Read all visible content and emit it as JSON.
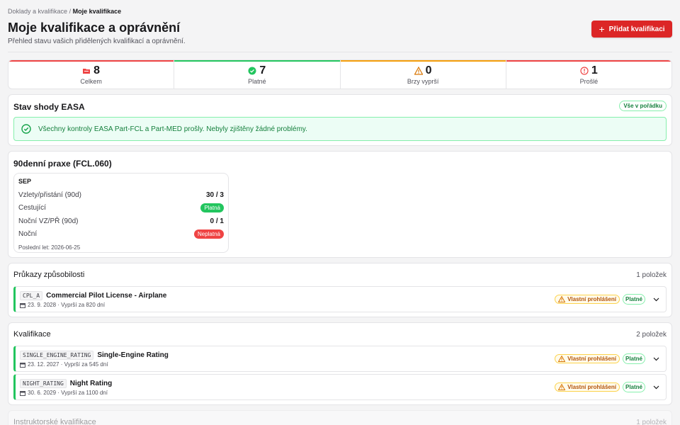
{
  "breadcrumb": {
    "parent": "Doklady a kvalifikace",
    "separator": "/",
    "current": "Moje kvalifikace"
  },
  "header": {
    "title": "Moje kvalifikace a oprávnění",
    "subtitle": "Přehled stavu vašich přidělených kvalifikací a oprávnění.",
    "add_button": "Přidat kvalifikaci"
  },
  "stats": [
    {
      "value": "8",
      "label": "Celkem",
      "icon": "folder-icon",
      "color": "#ef4444"
    },
    {
      "value": "7",
      "label": "Platné",
      "icon": "check-circle-icon",
      "color": "#22c55e"
    },
    {
      "value": "0",
      "label": "Brzy vyprší",
      "icon": "warning-icon",
      "color": "#f59e0b"
    },
    {
      "value": "1",
      "label": "Prošlé",
      "icon": "alert-circle-icon",
      "color": "#ef4444"
    }
  ],
  "easa": {
    "title": "Stav shody EASA",
    "badge": "Vše v pořádku",
    "message": "Všechny kontroly EASA Part-FCL a Part-MED prošly. Nebyly zjištěny žádné problémy."
  },
  "recency": {
    "title": "90denní praxe (FCL.060)",
    "type": "SEP",
    "rows": [
      {
        "label": "Vzlety/přistání (90d)",
        "value": "30 / 3"
      },
      {
        "label": "Cestující",
        "value": "Platná"
      },
      {
        "label": "Noční VZ/PŘ (90d)",
        "value": "0 / 1"
      },
      {
        "label": "Noční",
        "value": "Neplatná"
      }
    ],
    "last_flight": "Poslední let: 2026-06-25"
  },
  "licenses": {
    "title": "Průkazy způsobilosti",
    "count": "1 položek",
    "items": [
      {
        "code": "CPL_A",
        "name": "Commercial Pilot License - Airplane",
        "date": "23. 9. 2028 · Vyprší za 820 dní",
        "declaration": "Vlastní prohlášení",
        "status": "Platné"
      }
    ]
  },
  "ratings": {
    "title": "Kvalifikace",
    "count": "2 položek",
    "items": [
      {
        "code": "SINGLE_ENGINE_RATING",
        "name": "Single-Engine Rating",
        "date": "23. 12. 2027 · Vyprší za 545 dní",
        "declaration": "Vlastní prohlášení",
        "status": "Platné"
      },
      {
        "code": "NIGHT_RATING",
        "name": "Night Rating",
        "date": "30. 6. 2029 · Vyprší za 1100 dní",
        "declaration": "Vlastní prohlášení",
        "status": "Platné"
      }
    ]
  },
  "instructor": {
    "title": "Instruktorské kvalifikace",
    "count": "1 položek"
  }
}
